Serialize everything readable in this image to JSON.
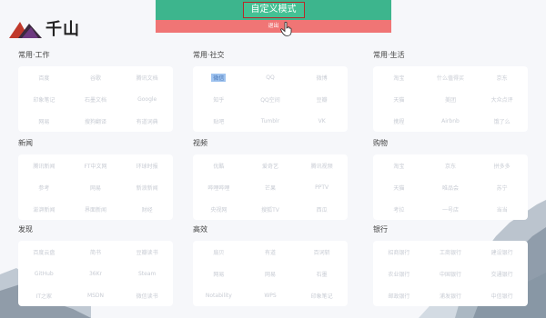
{
  "logo": {
    "text": "千山"
  },
  "banner": {
    "custom_mode": "自定义模式",
    "exit": "退出"
  },
  "sections": [
    {
      "title": "常用·工作",
      "links": [
        "百度",
        "谷歌",
        "腾讯文档",
        "印象笔记",
        "石墨文档",
        "Google",
        "网易",
        "搜狗翻译",
        "有道词典"
      ]
    },
    {
      "title": "常用·社交",
      "links": [
        "微信",
        "QQ",
        "微博",
        "知乎",
        "QQ空间",
        "豆瓣",
        "贴吧",
        "Tumblr",
        "VK"
      ]
    },
    {
      "title": "常用·生活",
      "links": [
        "淘宝",
        "什么值得买",
        "京东",
        "天猫",
        "美团",
        "大众点评",
        "携程",
        "Airbnb",
        "饿了么"
      ]
    },
    {
      "title": "新闻",
      "links": [
        "腾讯新闻",
        "FT中文网",
        "环球时报",
        "参考",
        "网易",
        "新浪新闻",
        "澎湃新闻",
        "界面新闻",
        "财经"
      ]
    },
    {
      "title": "视频",
      "links": [
        "优酷",
        "爱奇艺",
        "腾讯视频",
        "哔哩哔哩",
        "芒果",
        "PPTV",
        "央视网",
        "搜狐TV",
        "西瓜"
      ]
    },
    {
      "title": "购物",
      "links": [
        "淘宝",
        "京东",
        "拼多多",
        "天猫",
        "唯品会",
        "苏宁",
        "考拉",
        "一号店",
        "当当"
      ]
    },
    {
      "title": "发现",
      "links": [
        "百度云盘",
        "简书",
        "豆瓣读书",
        "GitHub",
        "36Kr",
        "Steam",
        "IT之家",
        "MSDN",
        "微信读书"
      ]
    },
    {
      "title": "高效",
      "links": [
        "扇贝",
        "有道",
        "百词斩",
        "网易",
        "网易",
        "石墨",
        "Notability",
        "WPS",
        "印象笔记"
      ]
    },
    {
      "title": "银行",
      "links": [
        "招商银行",
        "工商银行",
        "建设银行",
        "农业银行",
        "中国银行",
        "交通银行",
        "邮政银行",
        "浦发银行",
        "中信银行"
      ]
    }
  ],
  "selected_link": "微信",
  "colors": {
    "banner_green": "#3db58d",
    "banner_red": "#f07575",
    "background": "#f6f7fa"
  }
}
